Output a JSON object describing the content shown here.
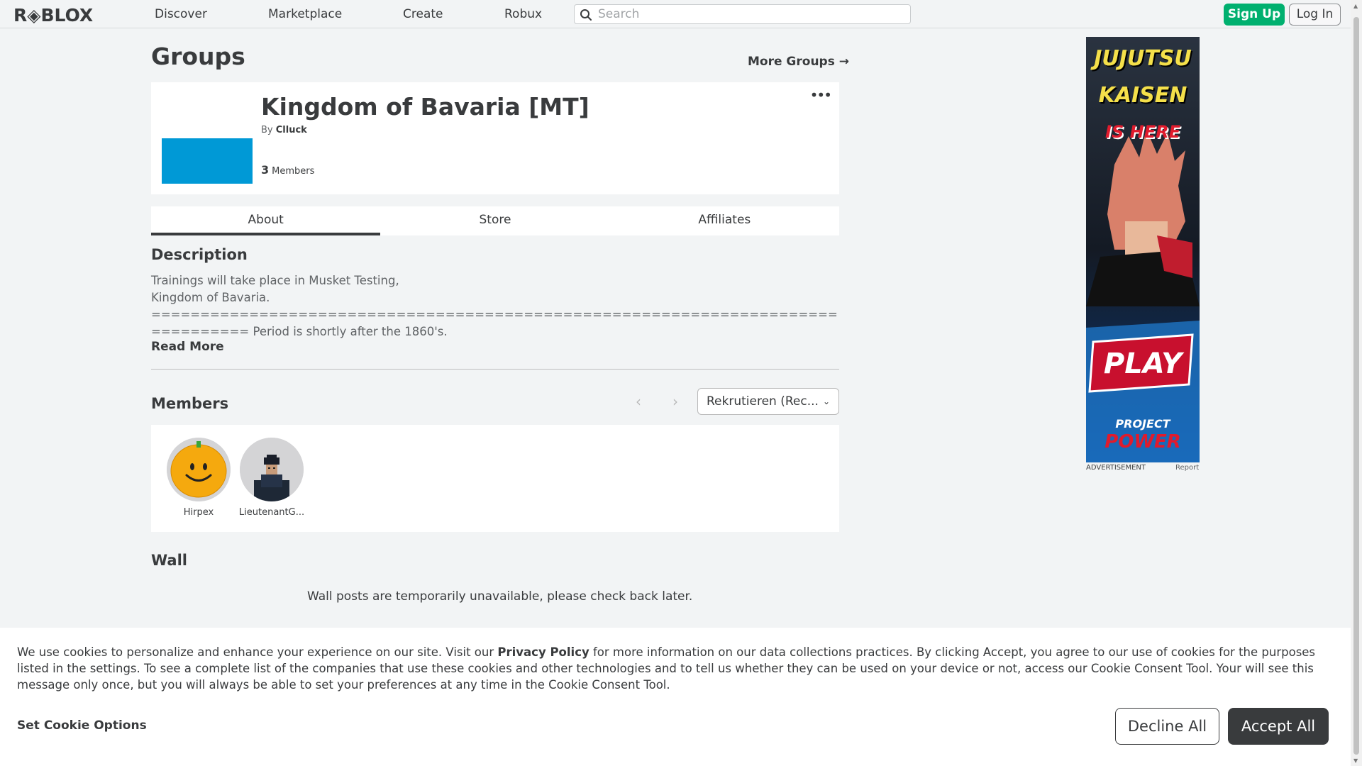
{
  "header": {
    "logo": "R◈BLOX",
    "nav": [
      "Discover",
      "Marketplace",
      "Create",
      "Robux"
    ],
    "search_placeholder": "Search",
    "signup_label": "Sign Up",
    "login_label": "Log In"
  },
  "page": {
    "title": "Groups",
    "more_groups": "More Groups →"
  },
  "group": {
    "name": "Kingdom of Bavaria [MT]",
    "owner_prefix": "By",
    "owner": "Clluck",
    "member_count": "3",
    "member_label": "Members",
    "menu_icon": "•••",
    "emblem_color": "#0099d6"
  },
  "tabs": [
    "About",
    "Store",
    "Affiliates"
  ],
  "active_tab": "About",
  "description": {
    "title": "Description",
    "text": "Trainings will take place in Musket Testing,\nKingdom of Bavaria.\n================================================================================ Period is shortly after the 1860's.",
    "read_more": "Read More"
  },
  "members": {
    "title": "Members",
    "role_selected": "Rekrutieren (Rec...",
    "list": [
      {
        "name": "Hirpex"
      },
      {
        "name": "LieutenantG..."
      }
    ]
  },
  "wall": {
    "title": "Wall",
    "message": "Wall posts are temporarily unavailable, please check back later."
  },
  "ad": {
    "label": "ADVERTISEMENT",
    "report": "Report",
    "line1": "JUJUTSU",
    "line2": "KAISEN",
    "line3": "IS HERE",
    "play": "PLAY",
    "brand1": "PROJECT",
    "brand2": "POWER"
  },
  "cookie": {
    "text_before": "We use cookies to personalize and enhance your experience on our site. Visit our ",
    "privacy_link": "Privacy Policy",
    "text_after": " for more information on our data collections practices. By clicking Accept, you agree to our use of cookies for the purposes listed in the settings. To see a complete list of the companies that use these cookies and other technologies and to tell us whether they can be used on your device or not, access our Cookie Consent Tool. Your will see this message only once, but you will always be able to set your preferences at any time in the Cookie Consent Tool.",
    "options_label": "Set Cookie Options",
    "decline_label": "Decline All",
    "accept_label": "Accept All"
  }
}
